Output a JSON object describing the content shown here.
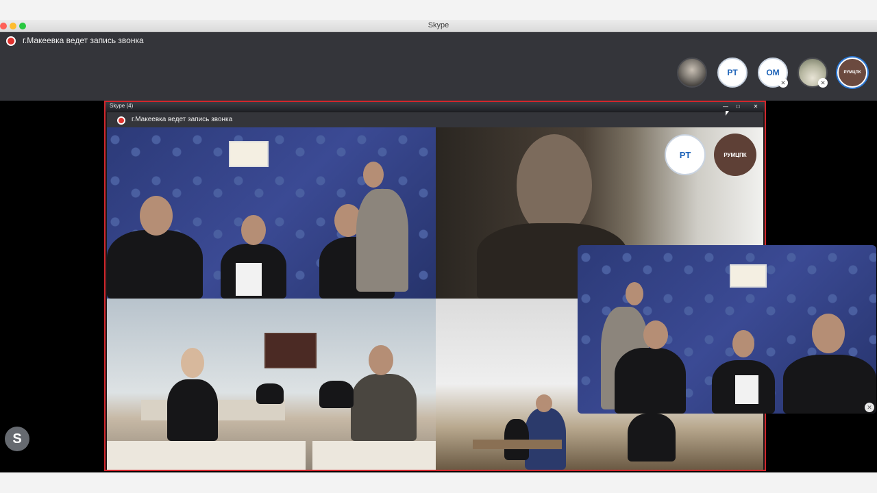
{
  "window": {
    "title": "Skype"
  },
  "call": {
    "recording_text": "г.Макеевка ведет запись звонка"
  },
  "participants": [
    {
      "type": "photo",
      "name": "avatar-photo-1"
    },
    {
      "type": "initials",
      "initials": "PT"
    },
    {
      "type": "initials",
      "initials": "OM",
      "muted": true
    },
    {
      "type": "photo",
      "name": "avatar-room",
      "muted": true
    },
    {
      "type": "logo",
      "logo_text": "РУМЦПК"
    }
  ],
  "inner_window": {
    "title": "Skype (4)",
    "recording_text": "г.Макеевка ведет запись звонка",
    "controls": {
      "minimize": "—",
      "maximize": "□",
      "close": "✕"
    },
    "tile_initials": "PT",
    "tile_logo": "РУМЦПК"
  },
  "sidebar": {
    "skype_label": "S"
  },
  "colors": {
    "record": "#e0322e",
    "accent_border": "#d2262c",
    "header_bg": "#34353a"
  }
}
